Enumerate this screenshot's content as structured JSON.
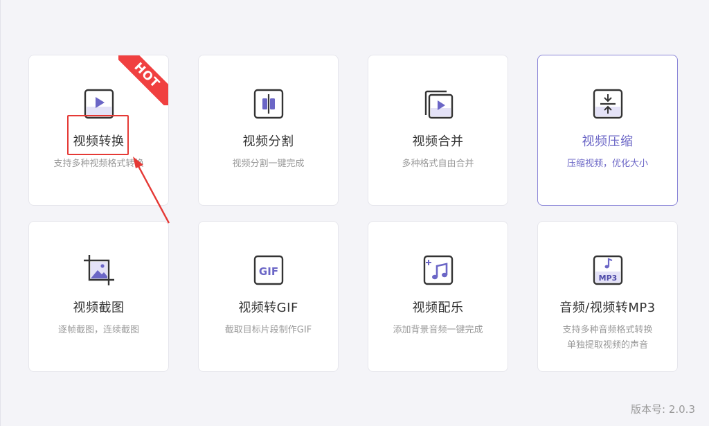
{
  "cards": [
    {
      "title": "视频转换",
      "subtitle": "支持多种视频格式转换",
      "badge": "HOT",
      "icon": "video-play-icon"
    },
    {
      "title": "视频分割",
      "subtitle": "视频分割一键完成",
      "icon": "split-icon"
    },
    {
      "title": "视频合并",
      "subtitle": "多种格式自由合并",
      "icon": "merge-icon"
    },
    {
      "title": "视频压缩",
      "subtitle": "压缩视频，优化大小",
      "icon": "compress-icon",
      "state": "selected"
    },
    {
      "title": "视频截图",
      "subtitle": "逐帧截图，连续截图",
      "icon": "crop-image-icon"
    },
    {
      "title": "视频转GIF",
      "subtitle": "截取目标片段制作GIF",
      "icon": "gif-icon"
    },
    {
      "title": "视频配乐",
      "subtitle": "添加背景音频一键完成",
      "icon": "music-add-icon"
    },
    {
      "title": "音频/视频转MP3",
      "subtitle": "支持多种音频格式转换",
      "subtitle2": "单独提取视频的声音",
      "icon": "mp3-icon"
    }
  ],
  "version": "版本号: 2.0.3",
  "colors": {
    "accent": "#6b66c6",
    "hot": "#f04040",
    "highlight": "#e53935"
  }
}
